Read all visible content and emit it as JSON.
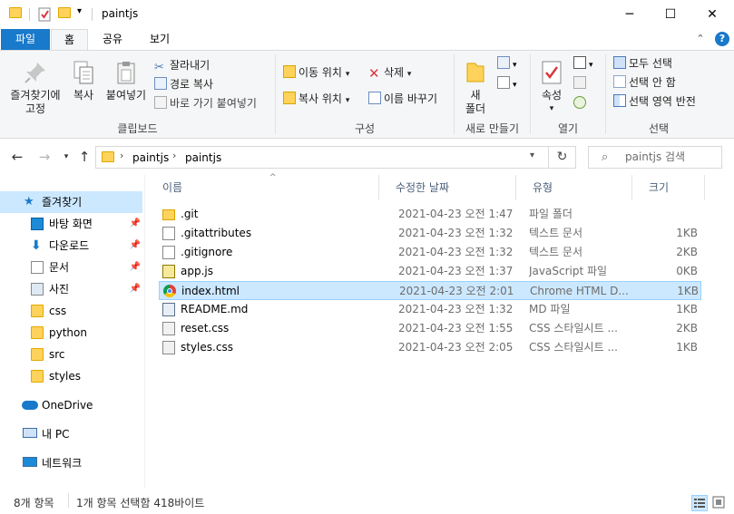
{
  "window": {
    "title": "paintjs",
    "minimize_glyph": "─",
    "maximize_glyph": "☐",
    "close_glyph": "✕"
  },
  "tabs": [
    {
      "label": "파일"
    },
    {
      "label": "홈"
    },
    {
      "label": "공유"
    },
    {
      "label": "보기"
    }
  ],
  "ribbon": {
    "clipboard": {
      "pin_label_1": "즐겨찾기에",
      "pin_label_2": "고정",
      "copy": "복사",
      "paste": "붙여넣기",
      "cut": "잘라내기",
      "copy_path": "경로 복사",
      "paste_shortcut": "바로 가기 붙여넣기",
      "group": "클립보드"
    },
    "organize": {
      "move_to": "이동 위치",
      "copy_to": "복사 위치",
      "delete": "삭제",
      "rename": "이름 바꾸기",
      "group": "구성"
    },
    "new": {
      "new_folder_1": "새",
      "new_folder_2": "폴더",
      "group": "새로 만들기"
    },
    "open": {
      "properties": "속성",
      "group": "열기"
    },
    "select": {
      "select_all": "모두 선택",
      "select_none": "선택 안 함",
      "invert": "선택 영역 반전",
      "group": "선택"
    }
  },
  "address": {
    "crumbs": [
      "paintjs",
      "paintjs"
    ],
    "search_placeholder": "paintjs 검색"
  },
  "nav": {
    "quick_access": "즐겨찾기",
    "items": [
      {
        "label": "바탕 화면",
        "icon": "desktop-icon"
      },
      {
        "label": "다운로드",
        "icon": "download-icon"
      },
      {
        "label": "문서",
        "icon": "documents-icon"
      },
      {
        "label": "사진",
        "icon": "pictures-icon"
      },
      {
        "label": "css",
        "icon": "folder-icon"
      },
      {
        "label": "python",
        "icon": "folder-icon"
      },
      {
        "label": "src",
        "icon": "folder-icon"
      },
      {
        "label": "styles",
        "icon": "folder-icon"
      }
    ],
    "onedrive": "OneDrive",
    "this_pc": "내 PC",
    "network": "네트워크"
  },
  "columns": {
    "name": "이름",
    "date": "수정한 날짜",
    "type": "유형",
    "size": "크기"
  },
  "files": [
    {
      "name": ".git",
      "date": "2021-04-23 오전 1:47",
      "type": "파일 폴더",
      "size": "",
      "icon": "folder-icon"
    },
    {
      "name": ".gitattributes",
      "date": "2021-04-23 오전 1:32",
      "type": "텍스트 문서",
      "size": "1KB",
      "icon": "text-file-icon"
    },
    {
      "name": ".gitignore",
      "date": "2021-04-23 오전 1:32",
      "type": "텍스트 문서",
      "size": "2KB",
      "icon": "text-file-icon"
    },
    {
      "name": "app.js",
      "date": "2021-04-23 오전 1:37",
      "type": "JavaScript 파일",
      "size": "0KB",
      "icon": "js-file-icon"
    },
    {
      "name": "index.html",
      "date": "2021-04-23 오전 2:01",
      "type": "Chrome HTML D...",
      "size": "1KB",
      "icon": "chrome-icon"
    },
    {
      "name": "README.md",
      "date": "2021-04-23 오전 1:32",
      "type": "MD 파일",
      "size": "1KB",
      "icon": "md-file-icon"
    },
    {
      "name": "reset.css",
      "date": "2021-04-23 오전 1:55",
      "type": "CSS 스타일시트 ...",
      "size": "2KB",
      "icon": "css-file-icon"
    },
    {
      "name": "styles.css",
      "date": "2021-04-23 오전 2:05",
      "type": "CSS 스타일시트 ...",
      "size": "1KB",
      "icon": "css-file-icon"
    }
  ],
  "status": {
    "count": "8개 항목",
    "selection": "1개 항목 선택함 418바이트"
  },
  "colors": {
    "accent": "#1979ca",
    "selection": "#cce8ff",
    "selection_border": "#99d1ff"
  }
}
